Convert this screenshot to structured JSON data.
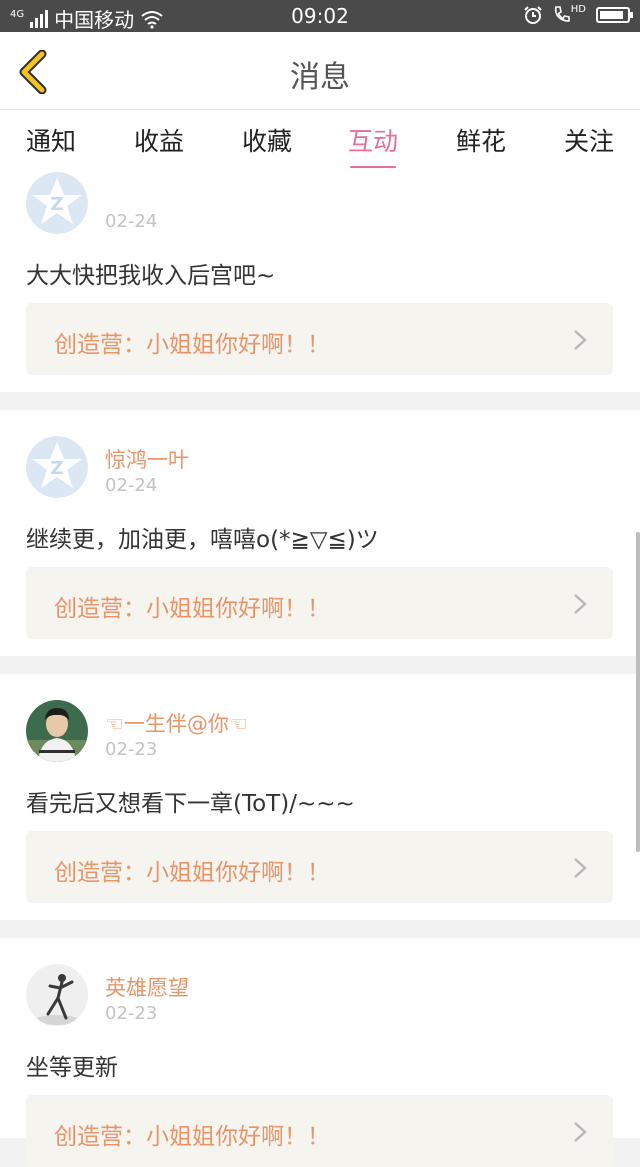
{
  "status": {
    "network": "4G",
    "carrier": "中国移动",
    "time": "09:02",
    "hd": "HD",
    "battery_level": 0.9
  },
  "header": {
    "title": "消息"
  },
  "tabs": [
    {
      "label": "通知"
    },
    {
      "label": "收益"
    },
    {
      "label": "收藏"
    },
    {
      "label": "互动",
      "active": true
    },
    {
      "label": "鲜花"
    },
    {
      "label": "关注"
    }
  ],
  "messages": [
    {
      "nick": "",
      "date": "02-24",
      "content": "大大快把我收入后宫吧~",
      "quote": "创造营：小姐姐你好啊！！",
      "avatar": "qq-default-avatar"
    },
    {
      "nick": "惊鸿一叶",
      "date": "02-24",
      "content": "继续更，加油更，嘻嘻o(*≧▽≦)ツ",
      "quote": "创造营：小姐姐你好啊！！",
      "avatar": "qq-default-avatar"
    },
    {
      "nick": "☜一生伴@你☜",
      "date": "02-23",
      "content": "看完后又想看下一章(ToT)/~~~",
      "quote": "创造营：小姐姐你好啊！！",
      "avatar": "photo-avatar-boy"
    },
    {
      "nick": "英雄愿望",
      "date": "02-23",
      "content": "坐等更新",
      "quote": "创造营：小姐姐你好啊！！",
      "avatar": "photo-avatar-dancer"
    }
  ],
  "colors": {
    "accent": "#e76d9a",
    "nick": "#e8956a",
    "back": "#f2c41b"
  }
}
